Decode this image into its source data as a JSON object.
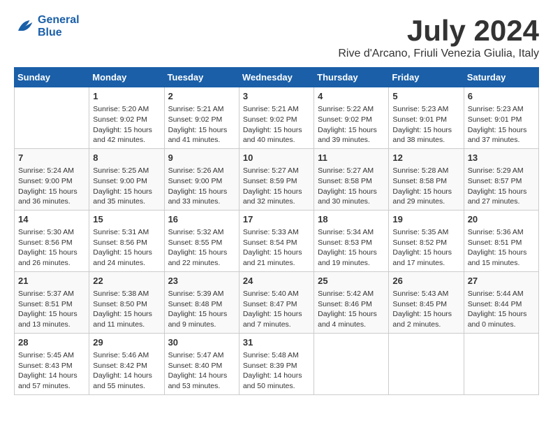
{
  "logo": {
    "line1": "General",
    "line2": "Blue"
  },
  "title": "July 2024",
  "subtitle": "Rive d'Arcano, Friuli Venezia Giulia, Italy",
  "days_of_week": [
    "Sunday",
    "Monday",
    "Tuesday",
    "Wednesday",
    "Thursday",
    "Friday",
    "Saturday"
  ],
  "weeks": [
    [
      {
        "day": "",
        "info": ""
      },
      {
        "day": "1",
        "info": "Sunrise: 5:20 AM\nSunset: 9:02 PM\nDaylight: 15 hours\nand 42 minutes."
      },
      {
        "day": "2",
        "info": "Sunrise: 5:21 AM\nSunset: 9:02 PM\nDaylight: 15 hours\nand 41 minutes."
      },
      {
        "day": "3",
        "info": "Sunrise: 5:21 AM\nSunset: 9:02 PM\nDaylight: 15 hours\nand 40 minutes."
      },
      {
        "day": "4",
        "info": "Sunrise: 5:22 AM\nSunset: 9:02 PM\nDaylight: 15 hours\nand 39 minutes."
      },
      {
        "day": "5",
        "info": "Sunrise: 5:23 AM\nSunset: 9:01 PM\nDaylight: 15 hours\nand 38 minutes."
      },
      {
        "day": "6",
        "info": "Sunrise: 5:23 AM\nSunset: 9:01 PM\nDaylight: 15 hours\nand 37 minutes."
      }
    ],
    [
      {
        "day": "7",
        "info": "Sunrise: 5:24 AM\nSunset: 9:00 PM\nDaylight: 15 hours\nand 36 minutes."
      },
      {
        "day": "8",
        "info": "Sunrise: 5:25 AM\nSunset: 9:00 PM\nDaylight: 15 hours\nand 35 minutes."
      },
      {
        "day": "9",
        "info": "Sunrise: 5:26 AM\nSunset: 9:00 PM\nDaylight: 15 hours\nand 33 minutes."
      },
      {
        "day": "10",
        "info": "Sunrise: 5:27 AM\nSunset: 8:59 PM\nDaylight: 15 hours\nand 32 minutes."
      },
      {
        "day": "11",
        "info": "Sunrise: 5:27 AM\nSunset: 8:58 PM\nDaylight: 15 hours\nand 30 minutes."
      },
      {
        "day": "12",
        "info": "Sunrise: 5:28 AM\nSunset: 8:58 PM\nDaylight: 15 hours\nand 29 minutes."
      },
      {
        "day": "13",
        "info": "Sunrise: 5:29 AM\nSunset: 8:57 PM\nDaylight: 15 hours\nand 27 minutes."
      }
    ],
    [
      {
        "day": "14",
        "info": "Sunrise: 5:30 AM\nSunset: 8:56 PM\nDaylight: 15 hours\nand 26 minutes."
      },
      {
        "day": "15",
        "info": "Sunrise: 5:31 AM\nSunset: 8:56 PM\nDaylight: 15 hours\nand 24 minutes."
      },
      {
        "day": "16",
        "info": "Sunrise: 5:32 AM\nSunset: 8:55 PM\nDaylight: 15 hours\nand 22 minutes."
      },
      {
        "day": "17",
        "info": "Sunrise: 5:33 AM\nSunset: 8:54 PM\nDaylight: 15 hours\nand 21 minutes."
      },
      {
        "day": "18",
        "info": "Sunrise: 5:34 AM\nSunset: 8:53 PM\nDaylight: 15 hours\nand 19 minutes."
      },
      {
        "day": "19",
        "info": "Sunrise: 5:35 AM\nSunset: 8:52 PM\nDaylight: 15 hours\nand 17 minutes."
      },
      {
        "day": "20",
        "info": "Sunrise: 5:36 AM\nSunset: 8:51 PM\nDaylight: 15 hours\nand 15 minutes."
      }
    ],
    [
      {
        "day": "21",
        "info": "Sunrise: 5:37 AM\nSunset: 8:51 PM\nDaylight: 15 hours\nand 13 minutes."
      },
      {
        "day": "22",
        "info": "Sunrise: 5:38 AM\nSunset: 8:50 PM\nDaylight: 15 hours\nand 11 minutes."
      },
      {
        "day": "23",
        "info": "Sunrise: 5:39 AM\nSunset: 8:48 PM\nDaylight: 15 hours\nand 9 minutes."
      },
      {
        "day": "24",
        "info": "Sunrise: 5:40 AM\nSunset: 8:47 PM\nDaylight: 15 hours\nand 7 minutes."
      },
      {
        "day": "25",
        "info": "Sunrise: 5:42 AM\nSunset: 8:46 PM\nDaylight: 15 hours\nand 4 minutes."
      },
      {
        "day": "26",
        "info": "Sunrise: 5:43 AM\nSunset: 8:45 PM\nDaylight: 15 hours\nand 2 minutes."
      },
      {
        "day": "27",
        "info": "Sunrise: 5:44 AM\nSunset: 8:44 PM\nDaylight: 15 hours\nand 0 minutes."
      }
    ],
    [
      {
        "day": "28",
        "info": "Sunrise: 5:45 AM\nSunset: 8:43 PM\nDaylight: 14 hours\nand 57 minutes."
      },
      {
        "day": "29",
        "info": "Sunrise: 5:46 AM\nSunset: 8:42 PM\nDaylight: 14 hours\nand 55 minutes."
      },
      {
        "day": "30",
        "info": "Sunrise: 5:47 AM\nSunset: 8:40 PM\nDaylight: 14 hours\nand 53 minutes."
      },
      {
        "day": "31",
        "info": "Sunrise: 5:48 AM\nSunset: 8:39 PM\nDaylight: 14 hours\nand 50 minutes."
      },
      {
        "day": "",
        "info": ""
      },
      {
        "day": "",
        "info": ""
      },
      {
        "day": "",
        "info": ""
      }
    ]
  ]
}
